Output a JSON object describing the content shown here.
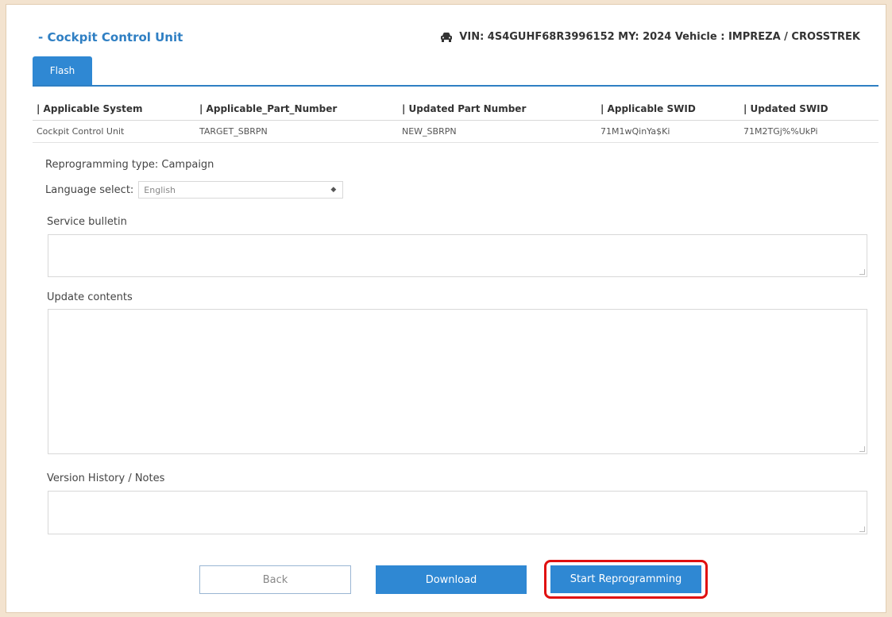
{
  "header": {
    "title": "- Cockpit Control Unit",
    "vehicle_info": "VIN: 4S4GUHF68R3996152 MY: 2024 Vehicle : IMPREZA / CROSSTREK",
    "vehicle_icon": "car-icon"
  },
  "tabs": [
    {
      "label": "Flash",
      "active": true
    }
  ],
  "table": {
    "headers": [
      "| Applicable System",
      "| Applicable_Part_Number",
      "| Updated Part Number",
      "| Applicable SWID",
      "| Updated SWID"
    ],
    "rows": [
      [
        "Cockpit Control Unit",
        "TARGET_SBRPN",
        "NEW_SBRPN",
        "71M1wQinYa$Ki",
        "71M2TGj%%UkPi"
      ]
    ]
  },
  "reprogramming_type": "Reprogramming type: Campaign",
  "language": {
    "label": "Language select:",
    "value": "English"
  },
  "fields": {
    "service_bulletin": {
      "label": "Service bulletin",
      "value": ""
    },
    "update_contents": {
      "label": "Update contents",
      "value": ""
    },
    "version_history": {
      "label": "Version History / Notes",
      "value": ""
    }
  },
  "buttons": {
    "back": "Back",
    "download": "Download",
    "start": "Start Reprogramming"
  },
  "colors": {
    "accent": "#2f88d3",
    "highlight": "#e01010"
  }
}
